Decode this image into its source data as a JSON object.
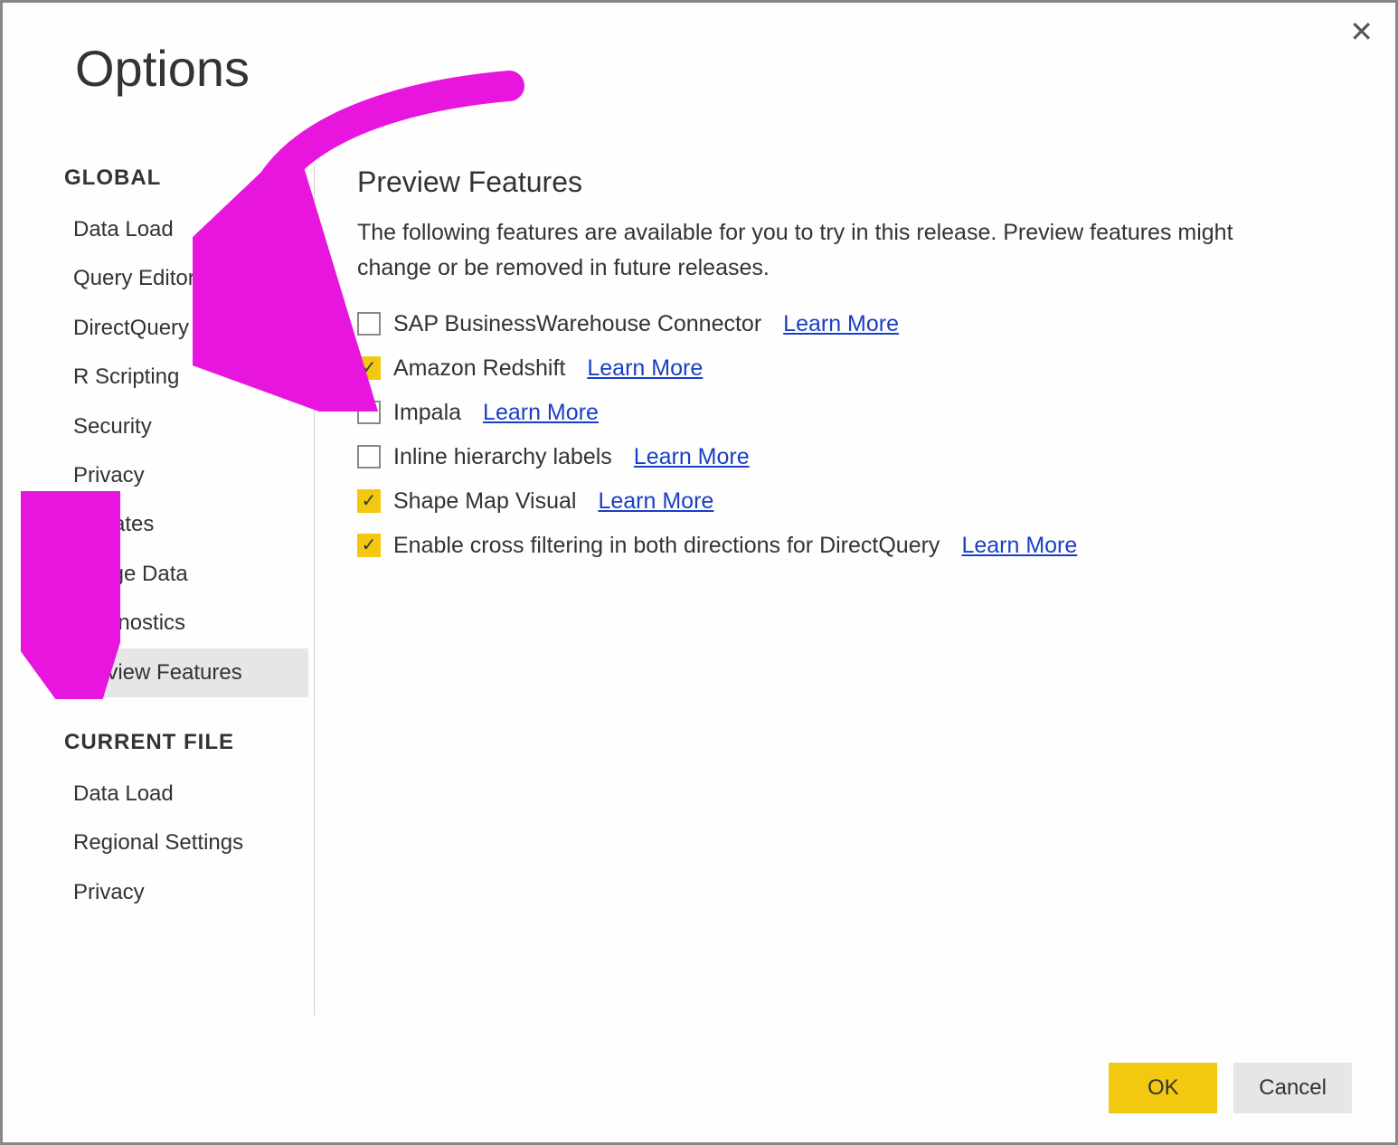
{
  "title": "Options",
  "close_glyph": "✕",
  "sidebar": {
    "sections": [
      {
        "header": "GLOBAL",
        "items": [
          {
            "label": "Data Load",
            "selected": false
          },
          {
            "label": "Query Editor",
            "selected": false
          },
          {
            "label": "DirectQuery",
            "selected": false
          },
          {
            "label": "R Scripting",
            "selected": false
          },
          {
            "label": "Security",
            "selected": false
          },
          {
            "label": "Privacy",
            "selected": false
          },
          {
            "label": "Updates",
            "selected": false
          },
          {
            "label": "Usage Data",
            "selected": false
          },
          {
            "label": "Diagnostics",
            "selected": false
          },
          {
            "label": "Preview Features",
            "selected": true
          }
        ]
      },
      {
        "header": "CURRENT FILE",
        "items": [
          {
            "label": "Data Load",
            "selected": false
          },
          {
            "label": "Regional Settings",
            "selected": false
          },
          {
            "label": "Privacy",
            "selected": false
          }
        ]
      }
    ]
  },
  "content": {
    "heading": "Preview Features",
    "description": "The following features are available for you to try in this release. Preview features might change or be removed in future releases.",
    "features": [
      {
        "label": "SAP BusinessWarehouse Connector",
        "checked": false,
        "learn": "Learn More"
      },
      {
        "label": "Amazon Redshift",
        "checked": true,
        "learn": "Learn More"
      },
      {
        "label": "Impala",
        "checked": false,
        "learn": "Learn More"
      },
      {
        "label": "Inline hierarchy labels",
        "checked": false,
        "learn": "Learn More"
      },
      {
        "label": "Shape Map Visual",
        "checked": true,
        "learn": "Learn More"
      },
      {
        "label": "Enable cross filtering in both directions for DirectQuery",
        "checked": true,
        "learn": "Learn More"
      }
    ]
  },
  "footer": {
    "ok": "OK",
    "cancel": "Cancel"
  },
  "colors": {
    "accent": "#f2c811",
    "link": "#1a3fc4",
    "annotation": "#e815de"
  }
}
